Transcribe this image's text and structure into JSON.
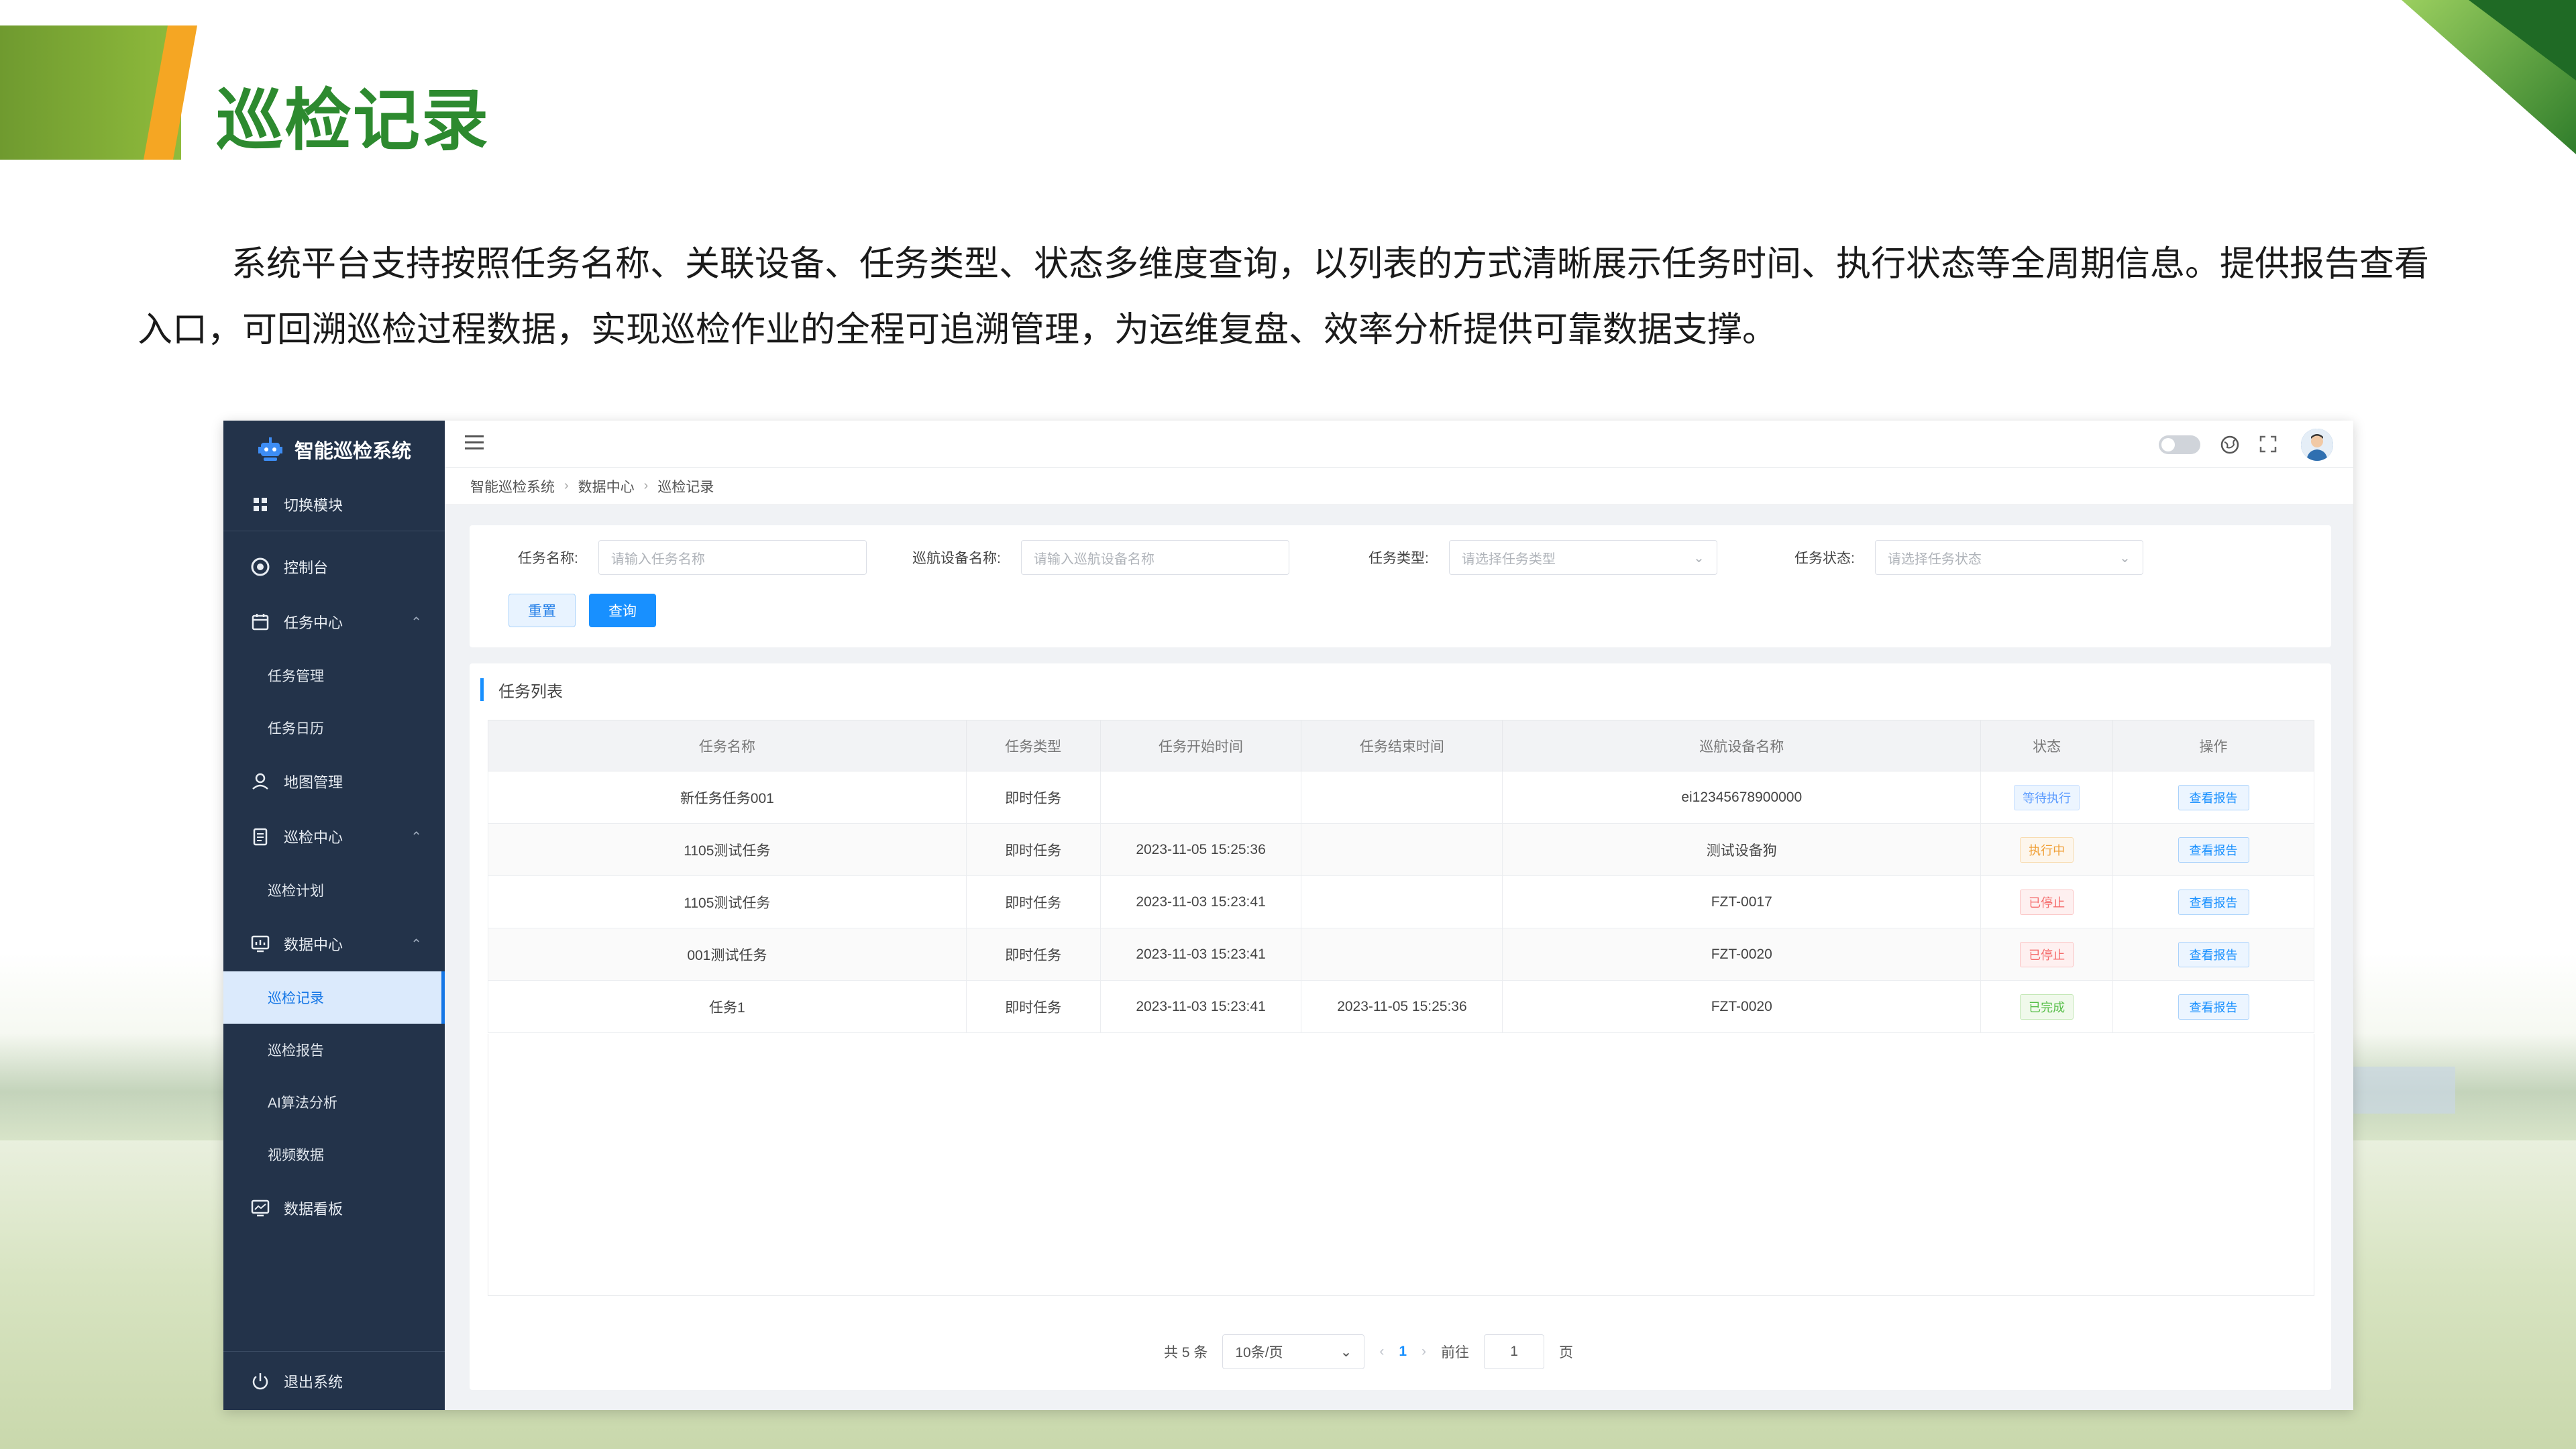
{
  "slide": {
    "title": "巡检记录",
    "intro": "系统平台支持按照任务名称、关联设备、任务类型、状态多维度查询，以列表的方式清晰展示任务时间、执行状态等全周期信息。提供报告查看入口，可回溯巡检过程数据，实现巡检作业的全程可追溯管理，为运维复盘、效率分析提供可靠数据支撑。",
    "colors": {
      "title_green": "#2d8a2f",
      "accent_orange": "#f5a623",
      "accent_green": "#8fbb3c"
    }
  },
  "app": {
    "system_name": "智能巡检系统",
    "switch_module": "切换模块",
    "sidebar": {
      "items": [
        {
          "label": "控制台",
          "icon": "dashboard-icon"
        },
        {
          "label": "任务中心",
          "icon": "calendar-icon",
          "expanded": true,
          "children": [
            {
              "label": "任务管理"
            },
            {
              "label": "任务日历"
            }
          ]
        },
        {
          "label": "地图管理",
          "icon": "map-pin-icon"
        },
        {
          "label": "巡检中心",
          "icon": "clipboard-icon",
          "expanded": true,
          "children": [
            {
              "label": "巡检计划"
            }
          ]
        },
        {
          "label": "数据中心",
          "icon": "chart-monitor-icon",
          "expanded": true,
          "children": [
            {
              "label": "巡检记录",
              "active": true
            },
            {
              "label": "巡检报告"
            },
            {
              "label": "AI算法分析"
            },
            {
              "label": "视频数据"
            }
          ]
        },
        {
          "label": "数据看板",
          "icon": "monitor-icon"
        }
      ],
      "logout": "退出系统"
    },
    "breadcrumb": [
      "智能巡检系统",
      "数据中心",
      "巡检记录"
    ],
    "filters": {
      "task_name": {
        "label": "任务名称:",
        "placeholder": "请输入任务名称"
      },
      "device_name": {
        "label": "巡航设备名称:",
        "placeholder": "请输入巡航设备名称"
      },
      "task_type": {
        "label": "任务类型:",
        "placeholder": "请选择任务类型"
      },
      "task_status": {
        "label": "任务状态:",
        "placeholder": "请选择任务状态"
      },
      "reset": "重置",
      "query": "查询"
    },
    "list": {
      "title": "任务列表",
      "columns": [
        "任务名称",
        "任务类型",
        "任务开始时间",
        "任务结束时间",
        "巡航设备名称",
        "状态",
        "操作"
      ],
      "rows": [
        {
          "name": "新任务任务001",
          "type": "即时任务",
          "start": "",
          "end": "",
          "device": "ei12345678900000",
          "status": "等待执行",
          "status_tone": "blue",
          "action": "查看报告"
        },
        {
          "name": "1105测试任务",
          "type": "即时任务",
          "start": "2023-11-05 15:25:36",
          "end": "",
          "device": "测试设备狗",
          "status": "执行中",
          "status_tone": "orange",
          "action": "查看报告"
        },
        {
          "name": "1105测试任务",
          "type": "即时任务",
          "start": "2023-11-03 15:23:41",
          "end": "",
          "device": "FZT-0017",
          "status": "已停止",
          "status_tone": "red",
          "action": "查看报告"
        },
        {
          "name": "001测试任务",
          "type": "即时任务",
          "start": "2023-11-03 15:23:41",
          "end": "",
          "device": "FZT-0020",
          "status": "已停止",
          "status_tone": "red",
          "action": "查看报告"
        },
        {
          "name": "任务1",
          "type": "即时任务",
          "start": "2023-11-03 15:23:41",
          "end": "2023-11-05 15:25:36",
          "device": "FZT-0020",
          "status": "已完成",
          "status_tone": "green",
          "action": "查看报告"
        }
      ]
    },
    "pager": {
      "total": "共 5 条",
      "page_size": "10条/页",
      "prev": "‹",
      "current_page": "1",
      "next": "›",
      "goto_label": "前往",
      "goto_value": "1",
      "page_suffix": "页"
    }
  }
}
